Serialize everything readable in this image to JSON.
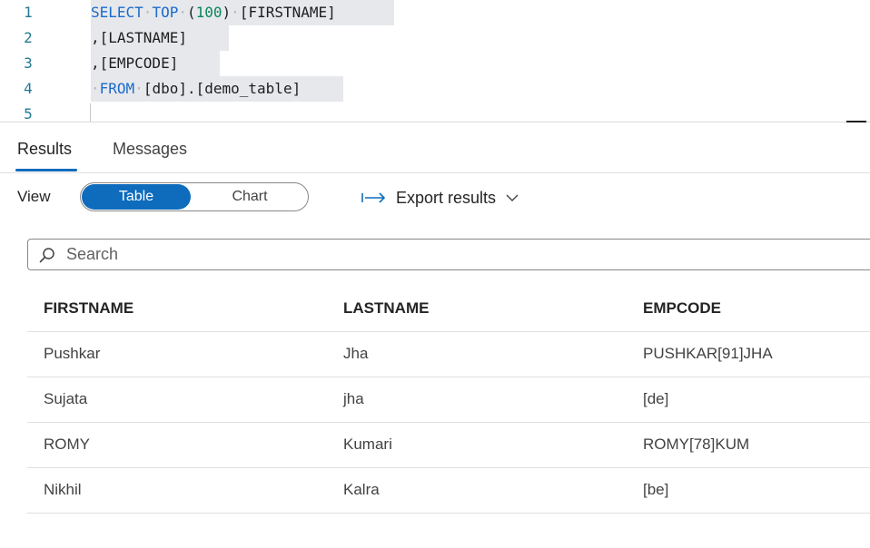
{
  "editor": {
    "lines": [
      {
        "num": "1",
        "tokens": [
          {
            "t": "SELECT",
            "c": "kw"
          },
          {
            "t": "·",
            "c": "ws"
          },
          {
            "t": "TOP",
            "c": "kw"
          },
          {
            "t": "·",
            "c": "ws"
          },
          {
            "t": "(",
            "c": "txt"
          },
          {
            "t": "100",
            "c": "num"
          },
          {
            "t": ")",
            "c": "txt"
          },
          {
            "t": "·",
            "c": "ws"
          },
          {
            "t": "[FIRSTNAME]",
            "c": "txt"
          }
        ]
      },
      {
        "num": "2",
        "tokens": [
          {
            "t": ",[LASTNAME]",
            "c": "txt"
          }
        ]
      },
      {
        "num": "3",
        "tokens": [
          {
            "t": ",[EMPCODE]",
            "c": "txt"
          }
        ]
      },
      {
        "num": "4",
        "tokens": [
          {
            "t": "·",
            "c": "ws"
          },
          {
            "t": "FROM",
            "c": "kw"
          },
          {
            "t": "·",
            "c": "ws"
          },
          {
            "t": "[dbo].[demo_table]",
            "c": "txt"
          }
        ]
      },
      {
        "num": "5",
        "tokens": []
      }
    ]
  },
  "tabs": {
    "results": "Results",
    "messages": "Messages"
  },
  "toolbar": {
    "view_label": "View",
    "table_label": "Table",
    "chart_label": "Chart",
    "export_label": "Export results"
  },
  "search": {
    "placeholder": "Search"
  },
  "colors": {
    "accent": "#0f6cbd",
    "keyword": "#1b6ac9",
    "number": "#098658",
    "line_number": "#237893"
  },
  "icons": [
    "export-arrow-icon",
    "chevron-down-icon",
    "search-icon"
  ],
  "table": {
    "columns": [
      "FIRSTNAME",
      "LASTNAME",
      "EMPCODE"
    ],
    "rows": [
      [
        "Pushkar",
        "Jha",
        "PUSHKAR[91]JHA"
      ],
      [
        "Sujata",
        "jha",
        "[de]"
      ],
      [
        "ROMY",
        "Kumari",
        "ROMY[78]KUM"
      ],
      [
        "Nikhil",
        "Kalra",
        "[be]"
      ]
    ]
  }
}
